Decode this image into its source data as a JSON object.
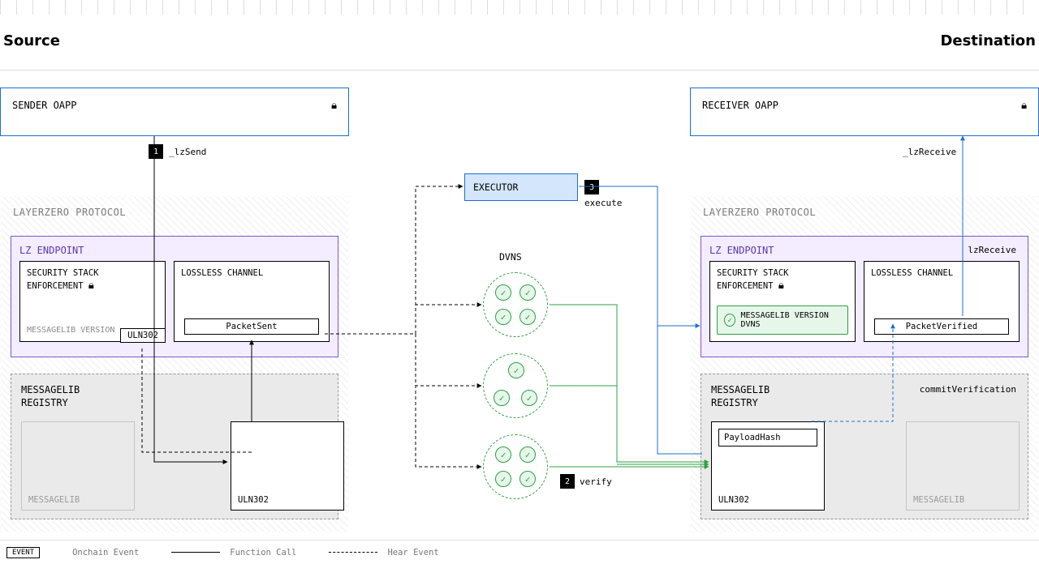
{
  "header": {
    "source": "Source",
    "destination": "Destination"
  },
  "oapp": {
    "sender": "SENDER OAPP",
    "receiver": "RECEIVER OAPP"
  },
  "steps": {
    "1": {
      "num": "1",
      "label": "_lzSend"
    },
    "2": {
      "num": "2",
      "label": "verify"
    },
    "3": {
      "num": "3",
      "label": "execute"
    }
  },
  "labels": {
    "protocol": "LAYERZERO PROTOCOL",
    "endpoint": "LZ ENDPOINT",
    "security": "SECURITY STACK ENFORCEMENT",
    "msglib_version": "MESSAGELIB VERSION",
    "lossless": "LOSSLESS CHANNEL",
    "uln": "ULN302",
    "packet_sent": "PacketSent",
    "packet_verified": "PacketVerified",
    "registry": "MESSAGELIB REGISTRY",
    "messagelib": "MESSAGELIB",
    "executor": "EXECUTOR",
    "dvns": "DVNS",
    "msglib_version_dvns": "MESSAGELIB VERSION DVNS",
    "payload_hash": "PayloadHash",
    "commit_verification": "commitVerification",
    "lz_receive": "lzReceive",
    "lz_receive_fn": "_lzReceive"
  },
  "legend": {
    "event": "EVENT",
    "onchain": "Onchain Event",
    "fncall": "Function Call",
    "hear": "Hear Event"
  }
}
